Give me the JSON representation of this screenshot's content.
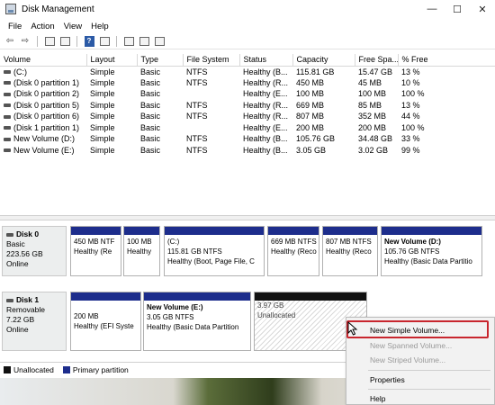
{
  "window": {
    "title": "Disk Management",
    "minimize": "—",
    "maximize": "☐",
    "close": "✕"
  },
  "menu": [
    "File",
    "Action",
    "View",
    "Help"
  ],
  "toolbar": {
    "back": "⇦",
    "forward": "⇨",
    "help": "?"
  },
  "table": {
    "columns": [
      "Volume",
      "Layout",
      "Type",
      "File System",
      "Status",
      "Capacity",
      "Free Spa...",
      "% Free"
    ],
    "rows": [
      [
        "(C:)",
        "Simple",
        "Basic",
        "NTFS",
        "Healthy (B...",
        "115.81 GB",
        "15.47 GB",
        "13 %"
      ],
      [
        "(Disk 0 partition 1)",
        "Simple",
        "Basic",
        "NTFS",
        "Healthy (R...",
        "450 MB",
        "45 MB",
        "10 %"
      ],
      [
        "(Disk 0 partition 2)",
        "Simple",
        "Basic",
        "",
        "Healthy (E...",
        "100 MB",
        "100 MB",
        "100 %"
      ],
      [
        "(Disk 0 partition 5)",
        "Simple",
        "Basic",
        "NTFS",
        "Healthy (R...",
        "669 MB",
        "85 MB",
        "13 %"
      ],
      [
        "(Disk 0 partition 6)",
        "Simple",
        "Basic",
        "NTFS",
        "Healthy (R...",
        "807 MB",
        "352 MB",
        "44 %"
      ],
      [
        "(Disk 1 partition 1)",
        "Simple",
        "Basic",
        "",
        "Healthy (E...",
        "200 MB",
        "200 MB",
        "100 %"
      ],
      [
        "New Volume (D:)",
        "Simple",
        "Basic",
        "NTFS",
        "Healthy (B...",
        "105.76 GB",
        "34.48 GB",
        "33 %"
      ],
      [
        "New Volume (E:)",
        "Simple",
        "Basic",
        "NTFS",
        "Healthy (B...",
        "3.05 GB",
        "3.02 GB",
        "99 %"
      ]
    ]
  },
  "disks": [
    {
      "name": "Disk 0",
      "type": "Basic",
      "size": "223.56 GB",
      "status": "Online",
      "partitions": [
        {
          "name": "",
          "size": "450 MB NTF",
          "status": "Healthy (Re"
        },
        {
          "name": "",
          "size": "100 MB",
          "status": "Healthy"
        },
        {
          "name": "(C:)",
          "size": "115.81 GB NTFS",
          "status": "Healthy (Boot, Page File, C"
        },
        {
          "name": "",
          "size": "669 MB NTFS",
          "status": "Healthy (Reco"
        },
        {
          "name": "",
          "size": "807 MB NTFS",
          "status": "Healthy (Reco"
        },
        {
          "name": "New Volume  (D:)",
          "size": "105.76 GB NTFS",
          "status": "Healthy (Basic Data Partitio"
        }
      ]
    },
    {
      "name": "Disk 1",
      "type": "Removable",
      "size": "7.22 GB",
      "status": "Online",
      "partitions": [
        {
          "name": "",
          "size": "200 MB",
          "status": "Healthy (EFI Syste"
        },
        {
          "name": "New Volume  (E:)",
          "size": "3.05 GB NTFS",
          "status": "Healthy (Basic Data Partition"
        },
        {
          "name": "",
          "size": "3.97 GB",
          "status": "Unallocated"
        }
      ]
    }
  ],
  "legend": [
    {
      "label": "Unallocated",
      "color": "#111111"
    },
    {
      "label": "Primary partition",
      "color": "#1d2d8c"
    }
  ],
  "context_menu": {
    "items": [
      "New Simple Volume...",
      "New Spanned Volume...",
      "New Striped Volume...",
      "Properties",
      "Help"
    ],
    "highlight_color": "#c8262e"
  }
}
